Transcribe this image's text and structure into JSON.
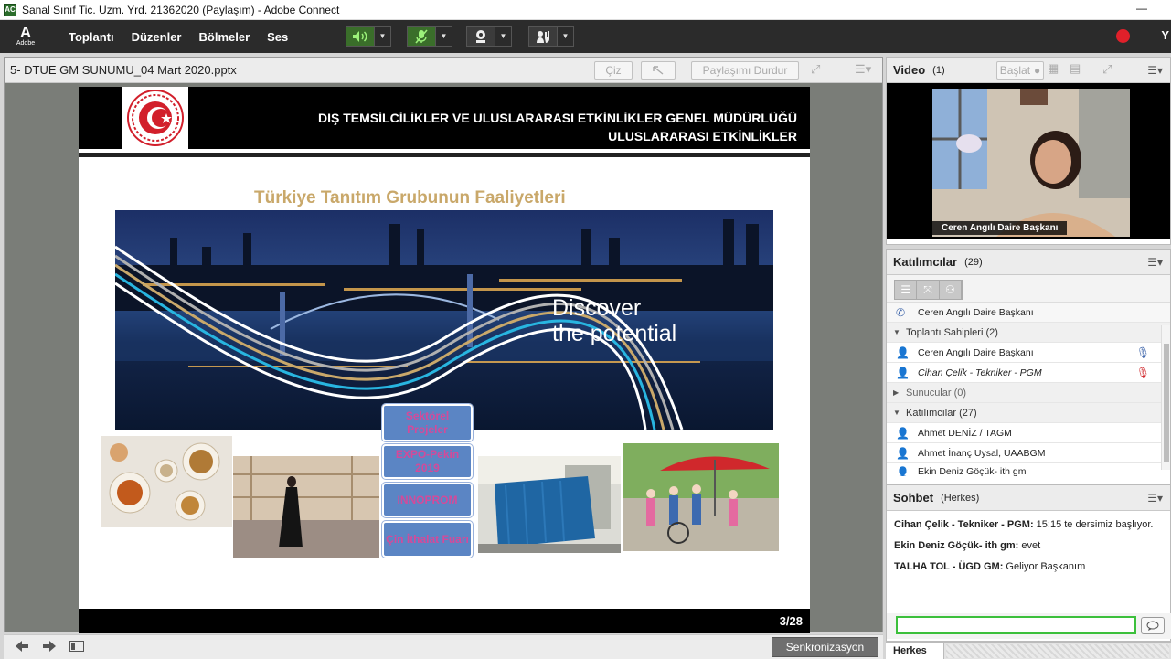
{
  "window": {
    "title": "Sanal Sınıf Tic. Uzm. Yrd. 21362020 (Paylaşım) - Adobe Connect",
    "app_icon_text": "AC",
    "minimize_glyph": "—"
  },
  "menubar": {
    "logo_letter": "A",
    "logo_text": "Adobe",
    "items": [
      "Toplantı",
      "Düzenler",
      "Bölmeler",
      "Ses"
    ],
    "tools": [
      {
        "icon": "speaker-icon",
        "state": "on",
        "color": "#3a6e2a"
      },
      {
        "icon": "microphone-muted-icon",
        "state": "on",
        "color": "#3a6e2a"
      },
      {
        "icon": "webcam-icon",
        "state": "off"
      },
      {
        "icon": "raise-hand-icon",
        "state": "off"
      }
    ],
    "record_color": "#e0202a",
    "user_initial": "Y"
  },
  "share_pod": {
    "filename": "5- DTUE GM SUNUMU_04 Mart 2020.pptx",
    "draw_button": "Çiz",
    "stop_sharing_button": "Paylaşımı Durdur"
  },
  "slide": {
    "header_line1": "DIŞ TEMSİLCİLİKLER VE ULUSLARARASI ETKİNLİKLER GENEL MÜDÜRLÜĞÜ",
    "header_line2": "ULUSLARARASI ETKİNLİKLER",
    "heading": "Türkiye Tanıtım Grubunun Faaliyetleri",
    "hero_line1": "Discover",
    "hero_line2": "the potential",
    "tags": [
      "Sektörel Projeler",
      "EXPO-Pekin 2019",
      "INNOPROM",
      "Çin İthalat Fuarı"
    ],
    "page_number": "3/28",
    "heading_color": "#c9a86a",
    "tag_color": "#5b85c4",
    "tag_text_color": "#d44a9a"
  },
  "bottom_bar": {
    "sync_button": "Senkronizasyon"
  },
  "video_pod": {
    "title": "Video",
    "count": "(1)",
    "start_button": "Başlat",
    "presenter_label": "Ceren Angılı Daire Başkanı"
  },
  "attendees_pod": {
    "title": "Katılımcılar",
    "count": "(29)",
    "current_speaker": "Ceren Angılı Daire Başkanı",
    "sections": [
      {
        "label": "Toplantı Sahipleri (2)",
        "expanded": true,
        "members": [
          {
            "name": "Ceren Angılı Daire Başkanı",
            "status": "speaking-icon"
          },
          {
            "name": "Cihan Çelik - Tekniker - PGM",
            "status": "mic-muted-icon"
          }
        ]
      },
      {
        "label": "Sunucular (0)",
        "expanded": false,
        "members": []
      },
      {
        "label": "Katılımcılar (27)",
        "expanded": true,
        "members": [
          {
            "name": "Ahmet DENİZ / TAGM"
          },
          {
            "name": "Ahmet İnanç Uysal, UAABGM"
          },
          {
            "name": "Ekin Deniz Göçük- ith gm"
          }
        ]
      }
    ]
  },
  "chat_pod": {
    "title": "Sohbet",
    "audience": "(Herkes)",
    "messages": [
      {
        "sender": "Cihan Çelik - Tekniker - PGM:",
        "text": "15:15 te dersimiz başlıyor."
      },
      {
        "sender": "Ekin Deniz Göçük- ith gm:",
        "text": "evet"
      },
      {
        "sender": "TALHA TOL - ÜGD GM:",
        "text": "Geliyor Başkanım"
      }
    ],
    "input_value": "",
    "footer_tab": "Herkes"
  }
}
